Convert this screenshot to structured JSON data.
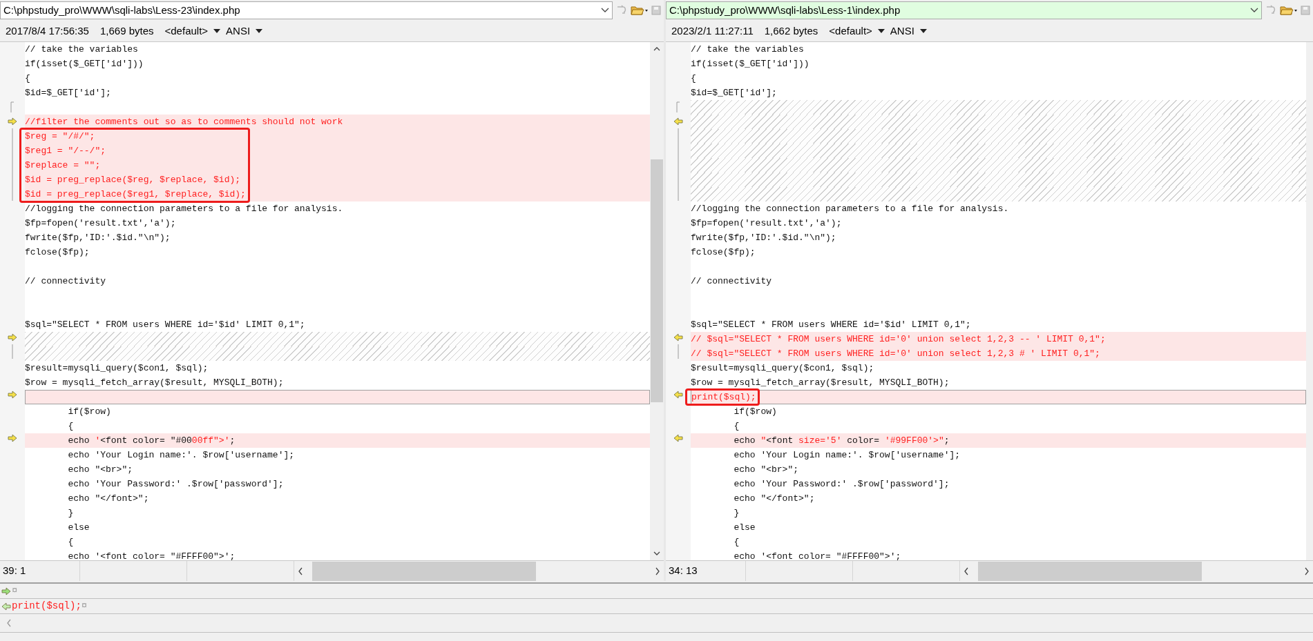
{
  "panes": [
    {
      "path": "C:\\phpstudy_pro\\WWW\\sqli-labs\\Less-23\\index.php",
      "active": false,
      "date": "2017/8/4 17:56:35",
      "size": "1,669 bytes",
      "codepage": "<default>",
      "encoding": "ANSI",
      "arrows": {
        "kind": "right"
      },
      "position": "39: 1",
      "lines": [
        {
          "kind": "normal",
          "text": "// take the variables"
        },
        {
          "kind": "normal",
          "text": "if(isset($_GET['id']))"
        },
        {
          "kind": "normal",
          "text": "{"
        },
        {
          "kind": "normal",
          "text": "$id=$_GET['id'];"
        },
        {
          "kind": "normal",
          "gutter": {
            "kind": "open"
          }
        },
        {
          "kind": "changed",
          "gutter": {
            "kind": "arrow"
          },
          "text": "//filter the comments out so as to comments should not work"
        },
        {
          "kind": "changed",
          "gutter": {
            "kind": "bar"
          },
          "boxed": true,
          "text": "$reg = \"/#/\";"
        },
        {
          "kind": "changed",
          "gutter": {
            "kind": "bar"
          },
          "boxed": true,
          "text": "$reg1 = \"/--/\";"
        },
        {
          "kind": "changed",
          "gutter": {
            "kind": "bar"
          },
          "boxed": true,
          "text": "$replace = \"\";"
        },
        {
          "kind": "changed",
          "gutter": {
            "kind": "bar"
          },
          "boxed": true,
          "text": "$id = preg_replace($reg, $replace, $id);"
        },
        {
          "kind": "changed",
          "gutter": {
            "kind": "bar"
          },
          "boxed": true,
          "text": "$id = preg_replace($reg1, $replace, $id);"
        },
        {
          "kind": "normal",
          "text": "//logging the connection parameters to a file for analysis."
        },
        {
          "kind": "normal",
          "text": "$fp=fopen('result.txt','a');"
        },
        {
          "kind": "normal",
          "text": "fwrite($fp,'ID:'.$id.\"\\n\");"
        },
        {
          "kind": "normal",
          "text": "fclose($fp);"
        },
        {
          "kind": "normal"
        },
        {
          "kind": "normal",
          "text": "// connectivity"
        },
        {
          "kind": "normal"
        },
        {
          "kind": "normal"
        },
        {
          "kind": "normal",
          "text": "$sql=\"SELECT * FROM users WHERE id='$id' LIMIT 0,1\";"
        },
        {
          "kind": "missing",
          "gutter": {
            "kind": "arrow"
          }
        },
        {
          "kind": "missing",
          "gutter": {
            "kind": "bar"
          }
        },
        {
          "kind": "normal",
          "text": "$result=mysqli_query($con1, $sql);"
        },
        {
          "kind": "normal",
          "text": "$row = mysqli_fetch_array($result, MYSQLI_BOTH);"
        },
        {
          "kind": "changed",
          "gutter": {
            "kind": "arrow"
          },
          "current": true
        },
        {
          "kind": "normal",
          "text": "        if($row)"
        },
        {
          "kind": "normal",
          "text": "        {"
        },
        {
          "kind": "changed",
          "gutter": {
            "kind": "arrow"
          },
          "parts": [
            {
              "text": "        echo ",
              "changed": false
            },
            {
              "text": "'",
              "changed": true
            },
            {
              "text": "<font color= \"#00",
              "changed": false
            },
            {
              "text": "00ff\">'",
              "changed": true
            },
            {
              "text": ";",
              "changed": false
            }
          ]
        },
        {
          "kind": "normal",
          "text": "        echo 'Your Login name:'. $row['username'];"
        },
        {
          "kind": "normal",
          "text": "        echo \"<br>\";"
        },
        {
          "kind": "normal",
          "text": "        echo 'Your Password:' .$row['password'];"
        },
        {
          "kind": "normal",
          "text": "        echo \"</font>\";"
        },
        {
          "kind": "normal",
          "text": "        }"
        },
        {
          "kind": "normal",
          "text": "        else"
        },
        {
          "kind": "normal",
          "text": "        {"
        },
        {
          "kind": "normal",
          "text": "        echo '<font color= \"#FFFF00\">';"
        }
      ]
    },
    {
      "path": "C:\\phpstudy_pro\\WWW\\sqli-labs\\Less-1\\index.php",
      "active": true,
      "date": "2023/2/1 11:27:11",
      "size": "1,662 bytes",
      "codepage": "<default>",
      "encoding": "ANSI",
      "arrows": {
        "kind": "left"
      },
      "position": "34: 13",
      "lines": [
        {
          "kind": "normal",
          "text": "// take the variables"
        },
        {
          "kind": "normal",
          "text": "if(isset($_GET['id']))"
        },
        {
          "kind": "normal",
          "text": "{"
        },
        {
          "kind": "normal",
          "text": "$id=$_GET['id'];"
        },
        {
          "kind": "missing",
          "gutter": {
            "kind": "open"
          }
        },
        {
          "kind": "missing",
          "gutter": {
            "kind": "arrow"
          }
        },
        {
          "kind": "missing",
          "gutter": {
            "kind": "bar"
          }
        },
        {
          "kind": "missing",
          "gutter": {
            "kind": "bar"
          }
        },
        {
          "kind": "missing",
          "gutter": {
            "kind": "bar"
          }
        },
        {
          "kind": "missing",
          "gutter": {
            "kind": "bar"
          }
        },
        {
          "kind": "missing",
          "gutter": {
            "kind": "bar"
          }
        },
        {
          "kind": "normal",
          "text": "//logging the connection parameters to a file for analysis."
        },
        {
          "kind": "normal",
          "text": "$fp=fopen('result.txt','a');"
        },
        {
          "kind": "normal",
          "text": "fwrite($fp,'ID:'.$id.\"\\n\");"
        },
        {
          "kind": "normal",
          "text": "fclose($fp);"
        },
        {
          "kind": "normal"
        },
        {
          "kind": "normal",
          "text": "// connectivity"
        },
        {
          "kind": "normal"
        },
        {
          "kind": "normal"
        },
        {
          "kind": "normal",
          "text": "$sql=\"SELECT * FROM users WHERE id='$id' LIMIT 0,1\";"
        },
        {
          "kind": "changed",
          "gutter": {
            "kind": "arrow"
          },
          "text": "// $sql=\"SELECT * FROM users WHERE id='0' union select 1,2,3 -- ' LIMIT 0,1\";"
        },
        {
          "kind": "changed",
          "gutter": {
            "kind": "bar"
          },
          "text": "// $sql=\"SELECT * FROM users WHERE id='0' union select 1,2,3 # ' LIMIT 0,1\";"
        },
        {
          "kind": "normal",
          "text": "$result=mysqli_query($con1, $sql);"
        },
        {
          "kind": "normal",
          "text": "$row = mysqli_fetch_array($result, MYSQLI_BOTH);"
        },
        {
          "kind": "changed",
          "gutter": {
            "kind": "arrow"
          },
          "current": true,
          "boxed": true,
          "text": "print($sql);"
        },
        {
          "kind": "normal",
          "text": "        if($row)"
        },
        {
          "kind": "normal",
          "text": "        {"
        },
        {
          "kind": "changed",
          "gutter": {
            "kind": "arrow"
          },
          "parts": [
            {
              "text": "        echo ",
              "changed": false
            },
            {
              "text": "\"",
              "changed": true
            },
            {
              "text": "<font ",
              "changed": false
            },
            {
              "text": "size='5'",
              "changed": true
            },
            {
              "text": " color= ",
              "changed": false
            },
            {
              "text": "'#99FF00'>\"",
              "changed": true
            },
            {
              "text": ";",
              "changed": false
            }
          ]
        },
        {
          "kind": "normal",
          "text": "        echo 'Your Login name:'. $row['username'];"
        },
        {
          "kind": "normal",
          "text": "        echo \"<br>\";"
        },
        {
          "kind": "normal",
          "text": "        echo 'Your Password:' .$row['password'];"
        },
        {
          "kind": "normal",
          "text": "        echo \"</font>\";"
        },
        {
          "kind": "normal",
          "text": "        }"
        },
        {
          "kind": "normal",
          "text": "        else"
        },
        {
          "kind": "normal",
          "text": "        {"
        },
        {
          "kind": "normal",
          "text": "        echo '<font color= \"#FFFF00\">';"
        }
      ]
    }
  ],
  "location_pane": {
    "rows": [
      {
        "arrow": {
          "kind": "right"
        },
        "parts": [
          {
            "text": "¤",
            "kind": "eol"
          }
        ]
      },
      {
        "arrow": {
          "kind": "left"
        },
        "parts": [
          {
            "text": "print($sql);",
            "kind": "changed"
          },
          {
            "text": "¤",
            "kind": "eol"
          }
        ]
      }
    ]
  }
}
